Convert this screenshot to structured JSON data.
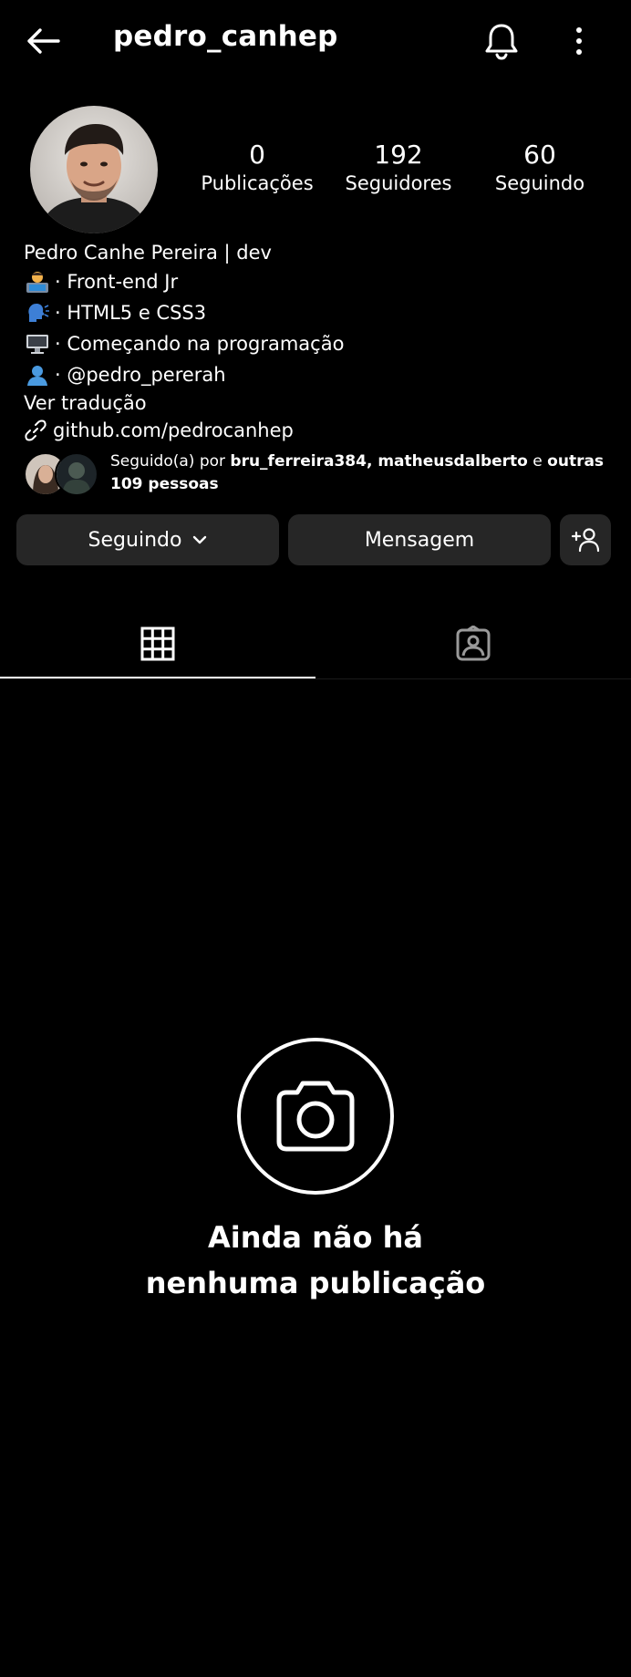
{
  "header": {
    "username": "pedro_canhep",
    "icons": {
      "back": "back-arrow-icon",
      "notifications": "bell-icon",
      "menu": "more-vertical-icon"
    }
  },
  "stats": {
    "posts": {
      "value": "0",
      "label": "Publicações"
    },
    "followers": {
      "value": "192",
      "label": "Seguidores"
    },
    "following": {
      "value": "60",
      "label": "Seguindo"
    }
  },
  "bio": {
    "name": "Pedro Canhe Pereira | dev",
    "lines": [
      {
        "emoji": "👨‍💻",
        "icon": "technologist-emoji",
        "text": "· Front-end Jr"
      },
      {
        "emoji": "🗣️",
        "icon": "speaking-head-emoji",
        "text": "· HTML5 e CSS3"
      },
      {
        "emoji": "🖥️",
        "icon": "desktop-computer-emoji",
        "text": "· Começando na programação"
      },
      {
        "emoji": "👤",
        "icon": "bust-silhouette-emoji",
        "text": "· @pedro_pererah"
      }
    ],
    "translate_label": "Ver tradução",
    "link": "github.com/pedrocanhep"
  },
  "followed_by": {
    "prefix": "Seguido(a) por ",
    "user1": "bru_ferreira384",
    "separator": ", ",
    "user2": "matheusdalberto",
    "conj": " e ",
    "others": "outras 109 pessoas"
  },
  "actions": {
    "following_label": "Seguindo",
    "message_label": "Mensagem"
  },
  "tabs": {
    "active": "grid",
    "icons": [
      "grid-icon",
      "tagged-user-icon"
    ]
  },
  "empty_state": {
    "line1": "Ainda não há",
    "line2": "nenhuma publicação"
  },
  "colors": {
    "background": "#000000",
    "button": "#262626",
    "text": "#ffffff"
  }
}
